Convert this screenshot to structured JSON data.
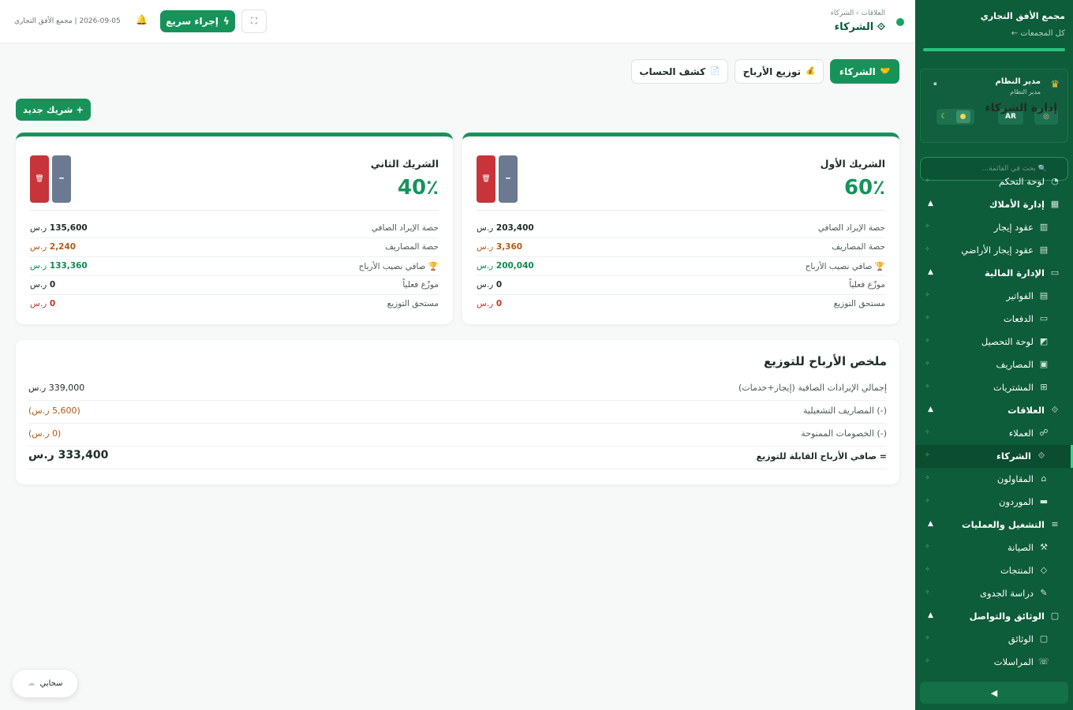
{
  "sidebar": {
    "title": "مجمع الأفق التجاري",
    "back_label": "← كل المجمعات",
    "user": {
      "name": "مدير النظام",
      "role": "مدير النظام"
    },
    "lang_label": "AR",
    "search_placeholder": "🔍 بحث في القائمة...",
    "items": [
      {
        "label": "لوحة التحكم",
        "kind": "item",
        "icon": "◔"
      },
      {
        "label": "إدارة الأملاك",
        "kind": "section",
        "icon": "▦"
      },
      {
        "label": "عقود إيجار",
        "kind": "sub",
        "icon": "▥"
      },
      {
        "label": "عقود إيجار الأراضي",
        "kind": "sub",
        "icon": "▤"
      },
      {
        "label": "الإدارة المالية",
        "kind": "section",
        "icon": "▭"
      },
      {
        "label": "الفواتير",
        "kind": "sub",
        "icon": "▤"
      },
      {
        "label": "الدفعات",
        "kind": "sub",
        "icon": "▭"
      },
      {
        "label": "لوحة التحصيل",
        "kind": "sub",
        "icon": "◩"
      },
      {
        "label": "المصاريف",
        "kind": "sub",
        "icon": "▣"
      },
      {
        "label": "المشتريات",
        "kind": "sub",
        "icon": "⊞"
      },
      {
        "label": "العلاقات",
        "kind": "section",
        "icon": "⟐"
      },
      {
        "label": "العملاء",
        "kind": "sub",
        "icon": "☍"
      },
      {
        "label": "الشركاء",
        "kind": "sub",
        "icon": "⟐",
        "active": true
      },
      {
        "label": "المقاولون",
        "kind": "sub",
        "icon": "⌂"
      },
      {
        "label": "الموردون",
        "kind": "sub",
        "icon": "▬"
      },
      {
        "label": "التشغيل والعمليات",
        "kind": "section",
        "icon": "≡"
      },
      {
        "label": "الصيانة",
        "kind": "sub",
        "icon": "⚒"
      },
      {
        "label": "المنتجات",
        "kind": "sub",
        "icon": "◇"
      },
      {
        "label": "دراسة الجدوى",
        "kind": "sub",
        "icon": "✎"
      },
      {
        "label": "الوثائق والتواصل",
        "kind": "section",
        "icon": "▢"
      },
      {
        "label": "الوثائق",
        "kind": "sub",
        "icon": "▢"
      },
      {
        "label": "المراسلات",
        "kind": "sub",
        "icon": "☏"
      }
    ],
    "collapse_icon": "◀"
  },
  "topbar": {
    "breadcrumb": "العلاقات › الشركاء",
    "page_title": "الشركاء",
    "quick_action_label": "إجراء سريع",
    "meta": "2026-09-05 | مجمع الأفق التجاري"
  },
  "tabs": [
    {
      "label": "الشركاء",
      "icon": "🤝",
      "active": true
    },
    {
      "label": "توزيع الأرباح",
      "icon": "💰",
      "active": false
    },
    {
      "label": "كشف الحساب",
      "icon": "📄",
      "active": false
    }
  ],
  "section_title": "إدارة الشركاء",
  "add_partner_label": "+ شريك جديد",
  "currency": "ر.س",
  "partners": [
    {
      "name": "الشريك الأول",
      "share": "60٪",
      "rows": [
        {
          "label": "حصة الإيراد الصافي",
          "value": "203,400"
        },
        {
          "label": "حصة المصاريف",
          "value": "3,360"
        },
        {
          "label": "🏆 صافي نصيب الأرباح",
          "value": "200,040"
        },
        {
          "label": "موزّع فعلياً",
          "value": "0"
        },
        {
          "label": "مستحق التوزيع",
          "value": "0"
        }
      ]
    },
    {
      "name": "الشريك الثاني",
      "share": "40٪",
      "rows": [
        {
          "label": "حصة الإيراد الصافي",
          "value": "135,600"
        },
        {
          "label": "حصة المصاريف",
          "value": "2,240"
        },
        {
          "label": "🏆 صافي نصيب الأرباح",
          "value": "133,360"
        },
        {
          "label": "موزّع فعلياً",
          "value": "0"
        },
        {
          "label": "مستحق التوزيع",
          "value": "0"
        }
      ]
    }
  ],
  "summary": {
    "title": "ملخص الأرباح للتوزيع",
    "rows": [
      {
        "label": "إجمالي الإيرادات الصافية (إيجار+خدمات)",
        "value": "339,000 ر.س"
      },
      {
        "label": "(-) المصاريف التشغيلية",
        "value": "(5,600 ر.س)"
      },
      {
        "label": "(-) الخصومات الممنوحة",
        "value": "(0 ر.س)"
      },
      {
        "label": "= صافي الأرباح القابلة للتوزيع",
        "value": "333,400 ر.س"
      }
    ]
  },
  "cloud_label": "سحابي",
  "colors": {
    "brand": "#0d5c3a",
    "accent": "#17935a",
    "danger": "#c7343a",
    "warning": "#b35a1a"
  }
}
